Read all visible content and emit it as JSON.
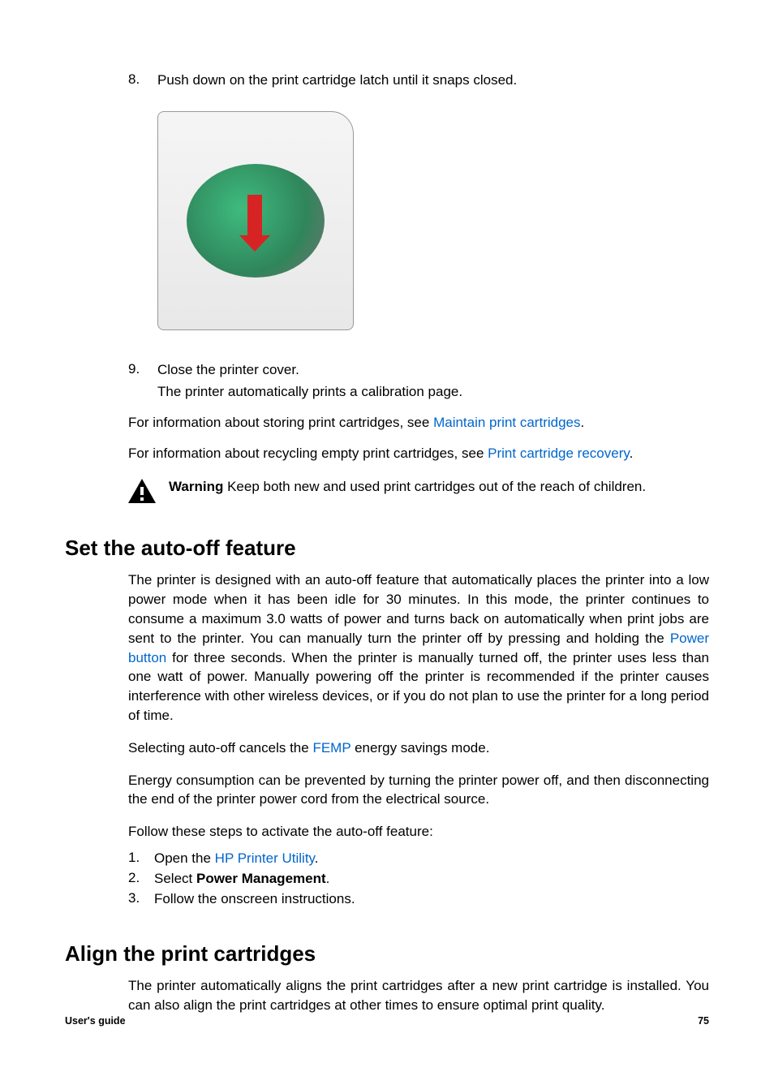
{
  "steps_top": {
    "s8": {
      "num": "8.",
      "text": "Push down on the print cartridge latch until it snaps closed."
    },
    "s9": {
      "num": "9.",
      "text": "Close the printer cover.",
      "subtext": "The printer automatically prints a calibration page."
    }
  },
  "info_storing": {
    "prefix": "For information about storing print cartridges, see ",
    "link": "Maintain print cartridges",
    "suffix": "."
  },
  "info_recycling": {
    "prefix": "For information about recycling empty print cartridges, see ",
    "link": "Print cartridge recovery",
    "suffix": "."
  },
  "warning": {
    "label": "Warning",
    "text": "   Keep both new and used print cartridges out of the reach of children."
  },
  "section_autooff": {
    "heading": "Set the auto-off feature",
    "p1_a": "The printer is designed with an auto-off feature that automatically places the printer into a low power mode when it has been idle for 30 minutes. In this mode, the printer continues to consume a maximum 3.0 watts of power and turns back on automatically when print jobs are sent to the printer. You can manually turn the printer off by pressing and holding the ",
    "p1_link": "Power button",
    "p1_b": " for three seconds. When the printer is manually turned off, the printer uses less than one watt of power. Manually powering off the printer is recommended if the printer causes interference with other wireless devices, or if you do not plan to use the printer for a long period of time.",
    "p2_a": "Selecting auto-off cancels the ",
    "p2_link": "FEMP",
    "p2_b": " energy savings mode.",
    "p3": "Energy consumption can be prevented by turning the printer power off, and then disconnecting the end of the printer power cord from the electrical source.",
    "p4": "Follow these steps to activate the auto-off feature:",
    "steps": {
      "s1": {
        "num": "1.",
        "prefix": "Open the ",
        "link": "HP Printer Utility",
        "suffix": "."
      },
      "s2": {
        "num": "2.",
        "prefix": "Select ",
        "bold": "Power Management",
        "suffix": "."
      },
      "s3": {
        "num": "3.",
        "text": "Follow the onscreen instructions."
      }
    }
  },
  "section_align": {
    "heading": "Align the print cartridges",
    "p1": "The printer automatically aligns the print cartridges after a new print cartridge is installed. You can also align the print cartridges at other times to ensure optimal print quality."
  },
  "footer": {
    "left": "User's guide",
    "right": "75"
  }
}
